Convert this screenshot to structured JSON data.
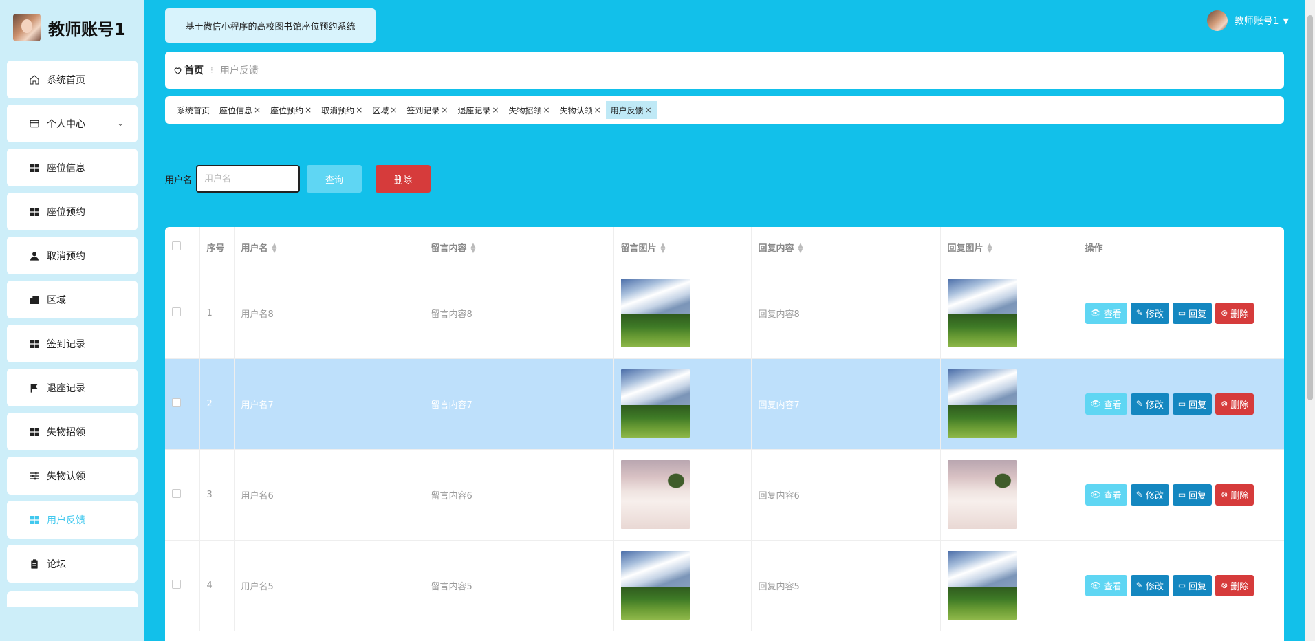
{
  "sidebar": {
    "title": "教师账号1",
    "items": [
      {
        "label": "系统首页",
        "icon": "home-icon"
      },
      {
        "label": "个人中心",
        "icon": "card-icon",
        "chevron": true
      },
      {
        "label": "座位信息",
        "icon": "grid-icon"
      },
      {
        "label": "座位预约",
        "icon": "grid-icon"
      },
      {
        "label": "取消预约",
        "icon": "user-icon"
      },
      {
        "label": "区域",
        "icon": "case-icon"
      },
      {
        "label": "签到记录",
        "icon": "grid-icon"
      },
      {
        "label": "退座记录",
        "icon": "flag-icon"
      },
      {
        "label": "失物招领",
        "icon": "grid-icon"
      },
      {
        "label": "失物认领",
        "icon": "sliders-icon"
      },
      {
        "label": "用户反馈",
        "icon": "grid-icon",
        "active": true
      },
      {
        "label": "论坛",
        "icon": "clipboard-icon"
      }
    ]
  },
  "header": {
    "system_title": "基于微信小程序的高校图书馆座位预约系统",
    "user_name": "教师账号1"
  },
  "breadcrumb": {
    "home": "首页",
    "current": "用户反馈"
  },
  "tags": [
    {
      "label": "系统首页",
      "closable": false
    },
    {
      "label": "座位信息",
      "closable": true
    },
    {
      "label": "座位预约",
      "closable": true
    },
    {
      "label": "取消预约",
      "closable": true
    },
    {
      "label": "区域",
      "closable": true
    },
    {
      "label": "签到记录",
      "closable": true
    },
    {
      "label": "退座记录",
      "closable": true
    },
    {
      "label": "失物招领",
      "closable": true
    },
    {
      "label": "失物认领",
      "closable": true
    },
    {
      "label": "用户反馈",
      "closable": true,
      "active": true
    }
  ],
  "search": {
    "label": "用户名",
    "placeholder": "用户名",
    "query_label": "查询",
    "delete_label": "删除"
  },
  "table": {
    "headers": [
      "序号",
      "用户名",
      "留言内容",
      "留言图片",
      "回复内容",
      "回复图片",
      "操作"
    ],
    "rows": [
      {
        "index": "1",
        "username": "用户名8",
        "content": "留言内容8",
        "image": "mountain",
        "reply": "回复内容8",
        "reply_image": "mountain"
      },
      {
        "index": "2",
        "username": "用户名7",
        "content": "留言内容7",
        "image": "mountain",
        "reply": "回复内容7",
        "reply_image": "mountain",
        "highlight": true
      },
      {
        "index": "3",
        "username": "用户名6",
        "content": "留言内容6",
        "image": "cloud",
        "reply": "回复内容6",
        "reply_image": "cloud"
      },
      {
        "index": "4",
        "username": "用户名5",
        "content": "留言内容5",
        "image": "mountain",
        "reply": "回复内容5",
        "reply_image": "mountain"
      }
    ],
    "actions": {
      "view": "查看",
      "edit": "修改",
      "reply": "回复",
      "delete": "删除"
    }
  },
  "colors": {
    "bg": "#12c0ea",
    "active": "#41c8ee",
    "danger": "#d63b3b",
    "primary": "#1487c0"
  }
}
